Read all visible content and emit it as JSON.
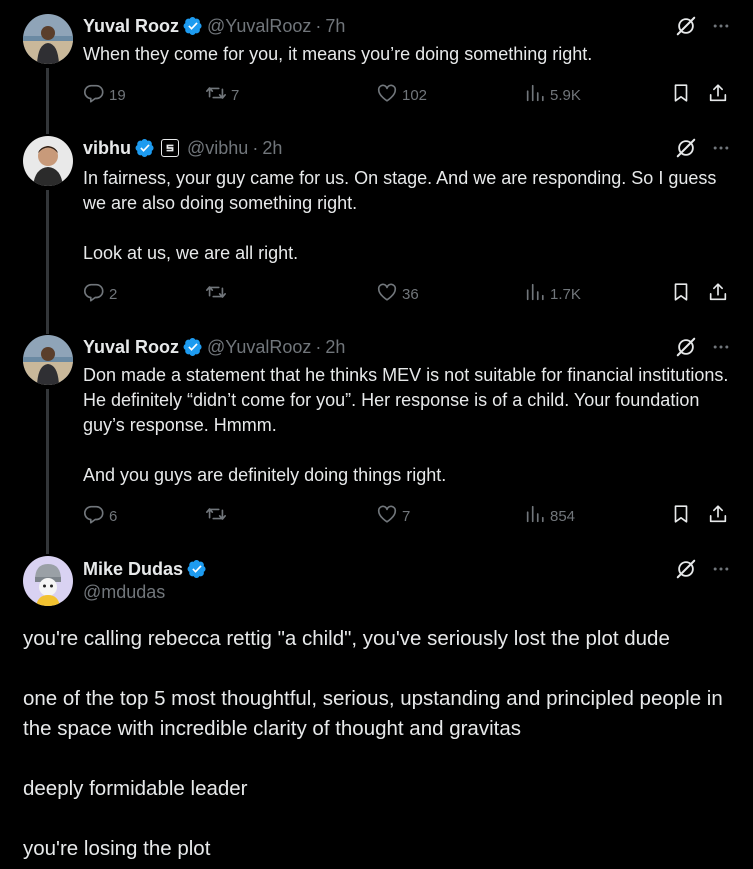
{
  "tweets": [
    {
      "name": "Yuval Rooz",
      "handle": "@YuvalRooz",
      "time": "7h",
      "body": [
        "When they come for you, it means you’re doing something right."
      ],
      "replies": "19",
      "retweets": "7",
      "likes": "102",
      "views": "5.9K"
    },
    {
      "name": "vibhu",
      "handle": "@vibhu",
      "time": "2h",
      "body": [
        "In fairness, your guy came for us. On stage. And we are responding. So I guess we are also doing something right.",
        "Look at us, we are all right."
      ],
      "replies": "2",
      "retweets": "",
      "likes": "36",
      "views": "1.7K"
    },
    {
      "name": "Yuval Rooz",
      "handle": "@YuvalRooz",
      "time": "2h",
      "body": [
        "Don made a statement that he thinks MEV is not suitable for financial institutions. He definitely “didn’t come for you”. Her response is of a child. Your foundation guy’s response. Hmmm.",
        "And you guys are definitely doing things right."
      ],
      "replies": "6",
      "retweets": "",
      "likes": "7",
      "views": "854"
    }
  ],
  "main": {
    "name": "Mike Dudas",
    "handle": "@mdudas",
    "body": [
      "you're calling rebecca rettig \"a child\", you've seriously lost the plot dude",
      "one of the top 5 most thoughtful, serious, upstanding and principled people in the space with incredible clarity of thought and gravitas",
      "deeply formidable leader",
      "you're losing the plot"
    ]
  },
  "icons": {
    "verified": "verified-badge-icon",
    "grok": "grok-icon",
    "more": "more-icon",
    "reply": "reply-icon",
    "retweet": "retweet-icon",
    "like": "like-icon",
    "views": "views-icon",
    "bookmark": "bookmark-icon",
    "share": "share-icon"
  },
  "colors": {
    "background": "#000000",
    "text": "#e7e9ea",
    "muted": "#71767b",
    "verified": "#1d9bf0",
    "thread_line": "#333639"
  }
}
